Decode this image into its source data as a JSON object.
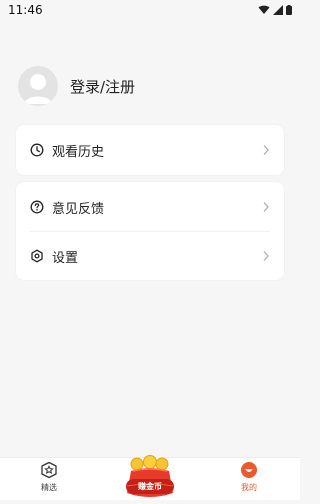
{
  "status_bar": {
    "time": "11:46",
    "icons": [
      "wifi-icon",
      "signal-icon",
      "battery-icon"
    ]
  },
  "profile": {
    "login_label": "登录/注册",
    "avatar_icon": "user-avatar-icon"
  },
  "menu": {
    "history": {
      "label": "观看历史",
      "icon": "clock-icon"
    },
    "feedback": {
      "label": "意见反馈",
      "icon": "question-circle-icon"
    },
    "settings": {
      "label": "设置",
      "icon": "gear-icon"
    }
  },
  "tabbar": {
    "featured": {
      "label": "精选",
      "icon": "star-box-icon"
    },
    "earn": {
      "label": "赚金币",
      "icon": "coin-bag-icon"
    },
    "mine": {
      "label": "我的",
      "icon": "smile-icon"
    }
  },
  "colors": {
    "accent": "#ea5a2c",
    "background": "#f6f6f6",
    "card": "#ffffff"
  }
}
